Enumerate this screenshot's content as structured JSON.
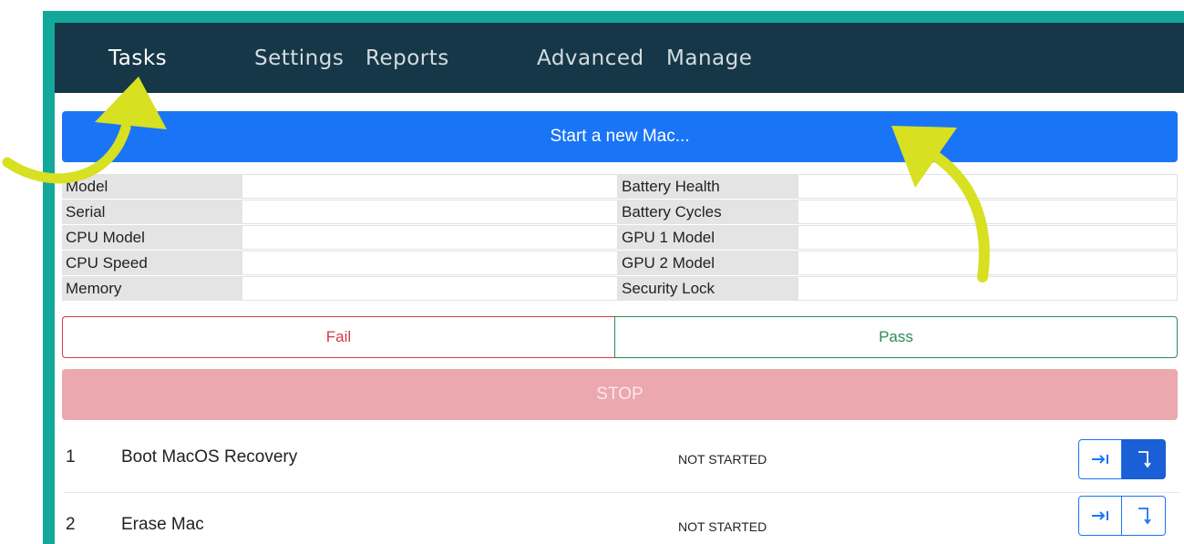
{
  "nav": {
    "items": [
      {
        "label": "Tasks",
        "active": true
      },
      {
        "label": "Settings",
        "active": false
      },
      {
        "label": "Reports",
        "active": false
      },
      {
        "label": "Advanced",
        "active": false
      },
      {
        "label": "Manage",
        "active": false
      }
    ]
  },
  "start_button": "Start a new Mac...",
  "info": {
    "left": [
      {
        "label": "Model",
        "value": ""
      },
      {
        "label": "Serial",
        "value": ""
      },
      {
        "label": "CPU Model",
        "value": ""
      },
      {
        "label": "CPU Speed",
        "value": ""
      },
      {
        "label": "Memory",
        "value": ""
      }
    ],
    "right": [
      {
        "label": "Battery Health",
        "value": ""
      },
      {
        "label": "Battery Cycles",
        "value": ""
      },
      {
        "label": "GPU 1 Model",
        "value": ""
      },
      {
        "label": "GPU 2 Model",
        "value": ""
      },
      {
        "label": "Security Lock",
        "value": ""
      }
    ]
  },
  "result": {
    "fail_label": "Fail",
    "pass_label": "Pass"
  },
  "stop_label": "STOP",
  "tasks": [
    {
      "num": "1",
      "name": "Boot MacOS Recovery",
      "status": "NOT STARTED"
    },
    {
      "num": "2",
      "name": "Erase Mac",
      "status": "NOT STARTED"
    }
  ],
  "colors": {
    "navbar": "#163747",
    "accent": "#1a74f6",
    "fail": "#d63a4b",
    "pass": "#2b8a5a",
    "stop": "#eba8ae",
    "frame": "#13a89a",
    "annotation_arrow": "#d7e021"
  }
}
